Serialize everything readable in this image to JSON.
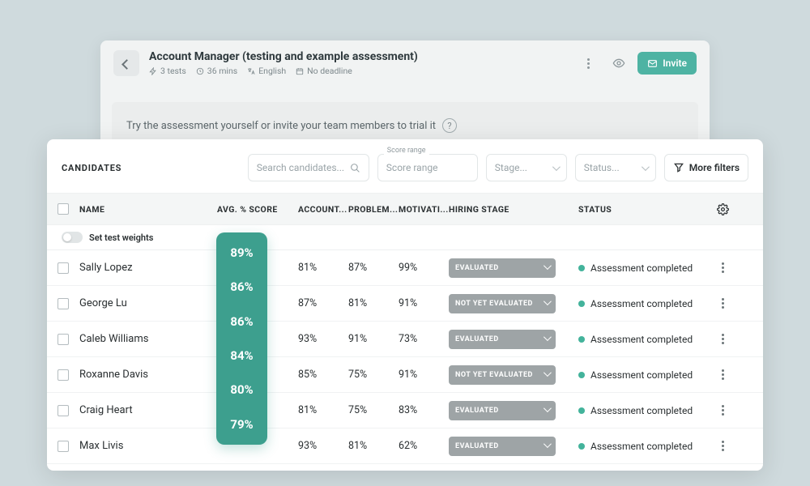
{
  "header": {
    "title": "Account Manager (testing and example assessment)",
    "meta": {
      "tests": "3 tests",
      "duration": "36 mins",
      "language": "English",
      "deadline": "No deadline"
    },
    "invite_label": "Invite"
  },
  "banner": {
    "text": "Try the assessment yourself or invite your team members to trial it"
  },
  "filters": {
    "section_label": "CANDIDATES",
    "search_placeholder": "Search candidates...",
    "score_range_label": "Score range",
    "score_range_placeholder": "Score range",
    "stage_placeholder": "Stage...",
    "status_placeholder": "Status...",
    "more_filters_label": "More filters"
  },
  "table": {
    "columns": {
      "name": "NAME",
      "avg": "AVG. % SCORE",
      "c1": "ACCOUNT...",
      "c2": "PROBLEM...",
      "c3": "MOTIVATI...",
      "stage": "HIRING STAGE",
      "status": "STATUS"
    },
    "weights_label": "Set test weights",
    "rows": [
      {
        "name": "Sally Lopez",
        "avg": "89%",
        "s1": "81%",
        "s2": "87%",
        "s3": "99%",
        "stage": "EVALUATED",
        "status": "Assessment completed"
      },
      {
        "name": "George Lu",
        "avg": "86%",
        "s1": "87%",
        "s2": "81%",
        "s3": "91%",
        "stage": "NOT YET EVALUATED",
        "status": "Assessment completed"
      },
      {
        "name": "Caleb Williams",
        "avg": "86%",
        "s1": "93%",
        "s2": "91%",
        "s3": "73%",
        "stage": "EVALUATED",
        "status": "Assessment completed"
      },
      {
        "name": "Roxanne Davis",
        "avg": "84%",
        "s1": "85%",
        "s2": "75%",
        "s3": "91%",
        "stage": "NOT YET EVALUATED",
        "status": "Assessment completed"
      },
      {
        "name": "Craig Heart",
        "avg": "80%",
        "s1": "81%",
        "s2": "75%",
        "s3": "83%",
        "stage": "EVALUATED",
        "status": "Assessment completed"
      },
      {
        "name": "Max Livis",
        "avg": "79%",
        "s1": "93%",
        "s2": "81%",
        "s3": "62%",
        "stage": "EVALUATED",
        "status": "Assessment completed"
      }
    ]
  },
  "colors": {
    "accent": "#3d9f8e",
    "status_dot": "#43b39b"
  }
}
